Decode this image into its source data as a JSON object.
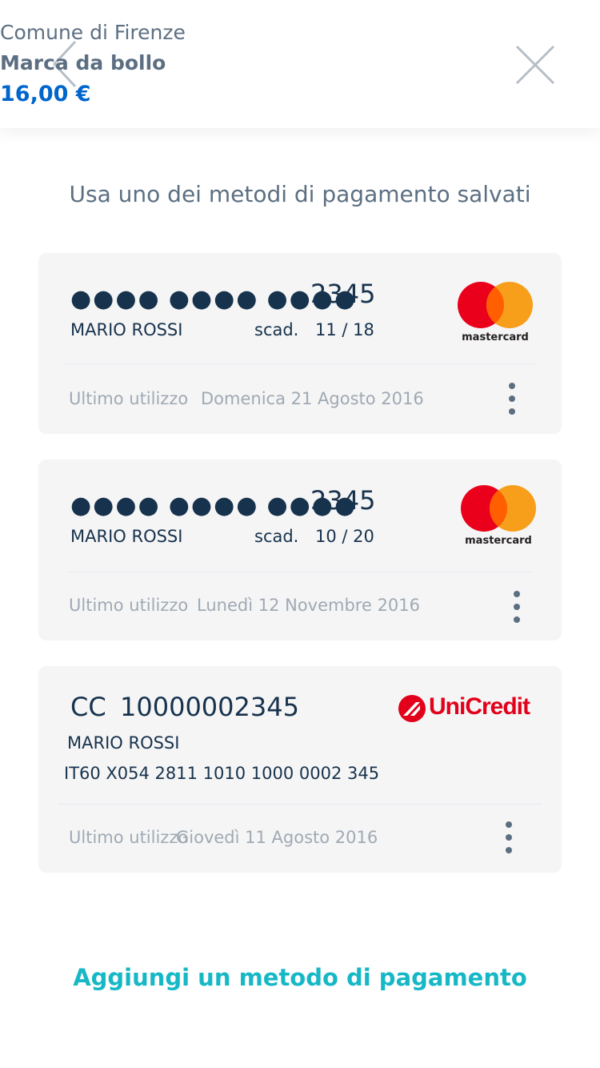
{
  "header": {
    "entity": "Comune di Firenze",
    "service": "Marca da bollo",
    "amount": "16,00 €",
    "back_icon": "chevron-left-icon",
    "close_icon": "close-icon"
  },
  "subtitle": "Usa uno dei metodi di pagamento salvati",
  "cards": [
    {
      "masked_groups": [
        "●●●●",
        "●●●●",
        "●●●●"
      ],
      "last4": "2345",
      "holder": "MARIO ROSSI",
      "expiry_label": "scad.",
      "expiry": "11 / 18",
      "brand": "mastercard",
      "last_used_label": "Ultimo utilizzo",
      "last_used_date": "Domenica 21 Agosto 2016"
    },
    {
      "masked_groups": [
        "●●●●",
        "●●●●",
        "●●●●"
      ],
      "last4": "2345",
      "holder": "MARIO ROSSI",
      "expiry_label": "scad.",
      "expiry": "10 / 20",
      "brand": "mastercard",
      "last_used_label": "Ultimo utilizzo",
      "last_used_date": "Lunedì 12 Novembre 2016"
    }
  ],
  "bank_account": {
    "type_label": "CC",
    "number": "10000002345",
    "holder": "MARIO ROSSI",
    "iban": "IT60 X054 2811 1010 1000 0002 345",
    "bank": "UniCredit",
    "last_used_label": "Ultimo utilizzo",
    "last_used_date": "Giovedì 11 Agosto 2016"
  },
  "add_method_label": "Aggiungi un metodo di pagamento",
  "colors": {
    "primary_text": "#5c6f82",
    "amount": "#0066cc",
    "link": "#17b8c6",
    "card_bg": "#f5f5f5",
    "mastercard_red": "#eb001b",
    "mastercard_yellow": "#f79e1b",
    "unicredit_red": "#e2001a"
  }
}
